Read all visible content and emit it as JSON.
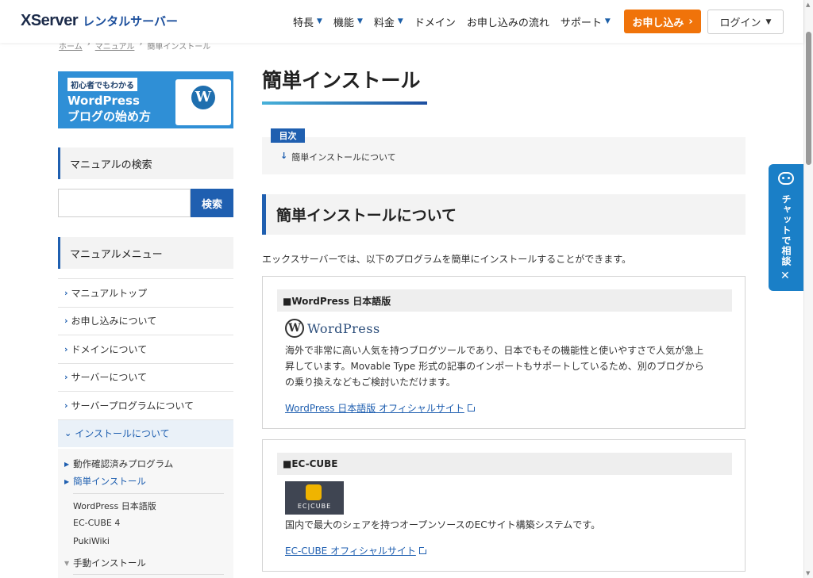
{
  "header": {
    "logo_main": "XServer",
    "logo_sub": "レンタルサーバー",
    "nav": [
      {
        "label": "特長",
        "chevron": true
      },
      {
        "label": "機能",
        "chevron": true
      },
      {
        "label": "料金",
        "chevron": true
      },
      {
        "label": "ドメイン",
        "chevron": false
      },
      {
        "label": "お申し込みの流れ",
        "chevron": false
      },
      {
        "label": "サポート",
        "chevron": true
      }
    ],
    "apply_label": "お申し込み",
    "login_label": "ログイン",
    "accent_color": "#f0730a",
    "brand_color": "#1f5fb0"
  },
  "breadcrumb": [
    "ホーム",
    "マニュアル",
    "簡単インストール"
  ],
  "sidebar": {
    "banner": {
      "tag": "初心者でもわかる",
      "line1": "WordPress",
      "line2": "ブログの始め方"
    },
    "search_heading": "マニュアルの検索",
    "search_placeholder": "",
    "search_button": "検索",
    "menu_heading": "マニュアルメニュー",
    "menu": [
      "マニュアルトップ",
      "お申し込みについて",
      "ドメインについて",
      "サーバーについて",
      "サーバープログラムについて",
      "インストールについて"
    ],
    "submenu": {
      "items": [
        "動作確認済みプログラム",
        "簡単インストール"
      ],
      "subitems": [
        "WordPress 日本語版",
        "EC-CUBE 4",
        "PukiWiki"
      ],
      "manual": "手動インストール"
    }
  },
  "main": {
    "title": "簡単インストール",
    "toc_label": "目次",
    "toc_items": [
      "簡単インストールについて"
    ],
    "section_heading": "簡単インストールについて",
    "intro": "エックスサーバーでは、以下のプログラムを簡単にインストールすることができます。",
    "cards": [
      {
        "heading": "■WordPress 日本語版",
        "logo_text": "WordPress",
        "desc_lines": [
          "海外で非常に高い人気を持つブログツールであり、日本でもその機能性と使いやすさで人気が急上",
          "昇しています。Movable Type 形式の記事のインポートもサポートしているため、別のブログから",
          "の乗り換えなどもご検討いただけます。"
        ],
        "link": "WordPress 日本語版 オフィシャルサイト"
      },
      {
        "heading": "■EC-CUBE",
        "logo_text": "EC|CUBE",
        "desc_lines": [
          "国内で最大のシェアを持つオープンソースのECサイト構築システムです。"
        ],
        "link": "EC-CUBE オフィシャルサイト"
      }
    ]
  },
  "chat": {
    "label": "チャットで相談",
    "close": "✕"
  }
}
